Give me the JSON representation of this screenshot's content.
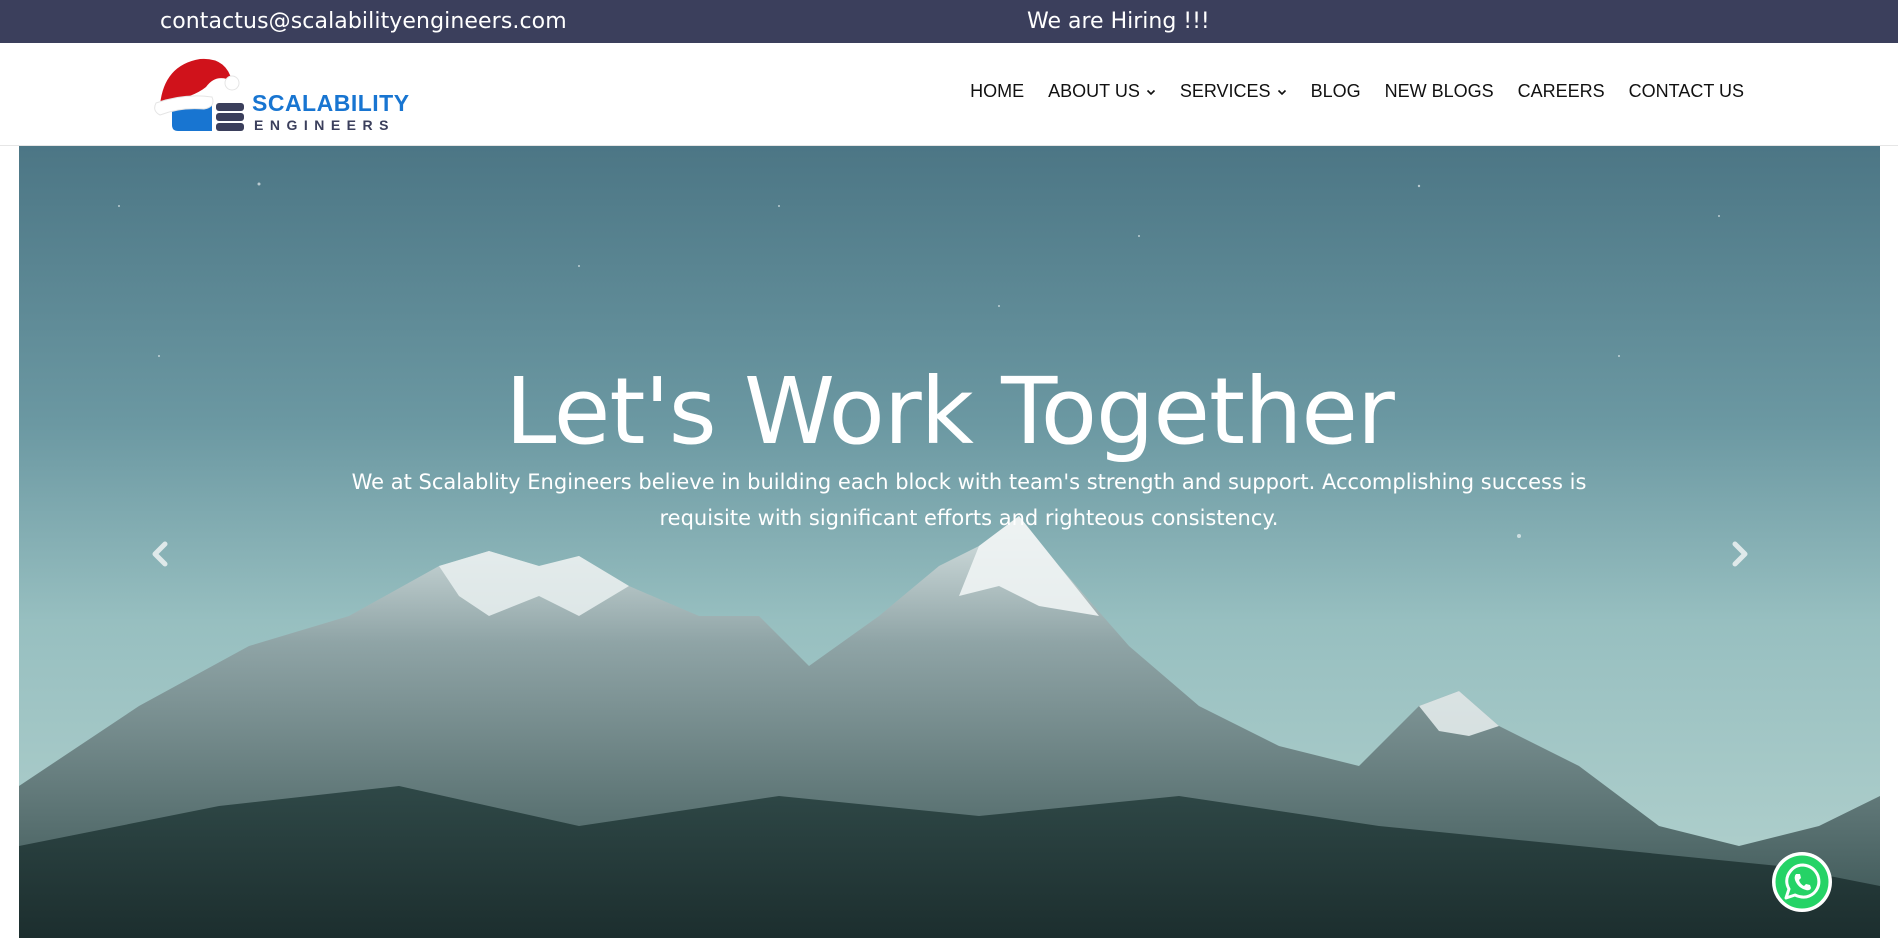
{
  "topbar": {
    "email": "contactus@scalabilityengineers.com",
    "hiring": "We are Hiring !!!"
  },
  "logo": {
    "line1": "SCALABILITY",
    "line2": "ENGINEERS"
  },
  "nav": {
    "items": [
      {
        "label": "HOME",
        "dropdown": false
      },
      {
        "label": "ABOUT US",
        "dropdown": true
      },
      {
        "label": "SERVICES",
        "dropdown": true
      },
      {
        "label": "BLOG",
        "dropdown": false
      },
      {
        "label": "NEW BLOGS",
        "dropdown": false
      },
      {
        "label": "CAREERS",
        "dropdown": false
      },
      {
        "label": "CONTACT US",
        "dropdown": false
      }
    ]
  },
  "hero": {
    "title": "Let's Work Together",
    "text": "We at Scalablity Engineers believe in building each block with team's strength and support. Accomplishing success is requisite with significant efforts and righteous consistency."
  },
  "icons": {
    "prev": "chevron-left-icon",
    "next": "chevron-right-icon",
    "whatsapp": "whatsapp-icon",
    "logo": "santa-hat-logo"
  },
  "colors": {
    "topbar_bg": "#3b3f5c",
    "brand_blue": "#1875d1",
    "brand_dark": "#3b3f5c",
    "whatsapp_green": "#25d366"
  }
}
